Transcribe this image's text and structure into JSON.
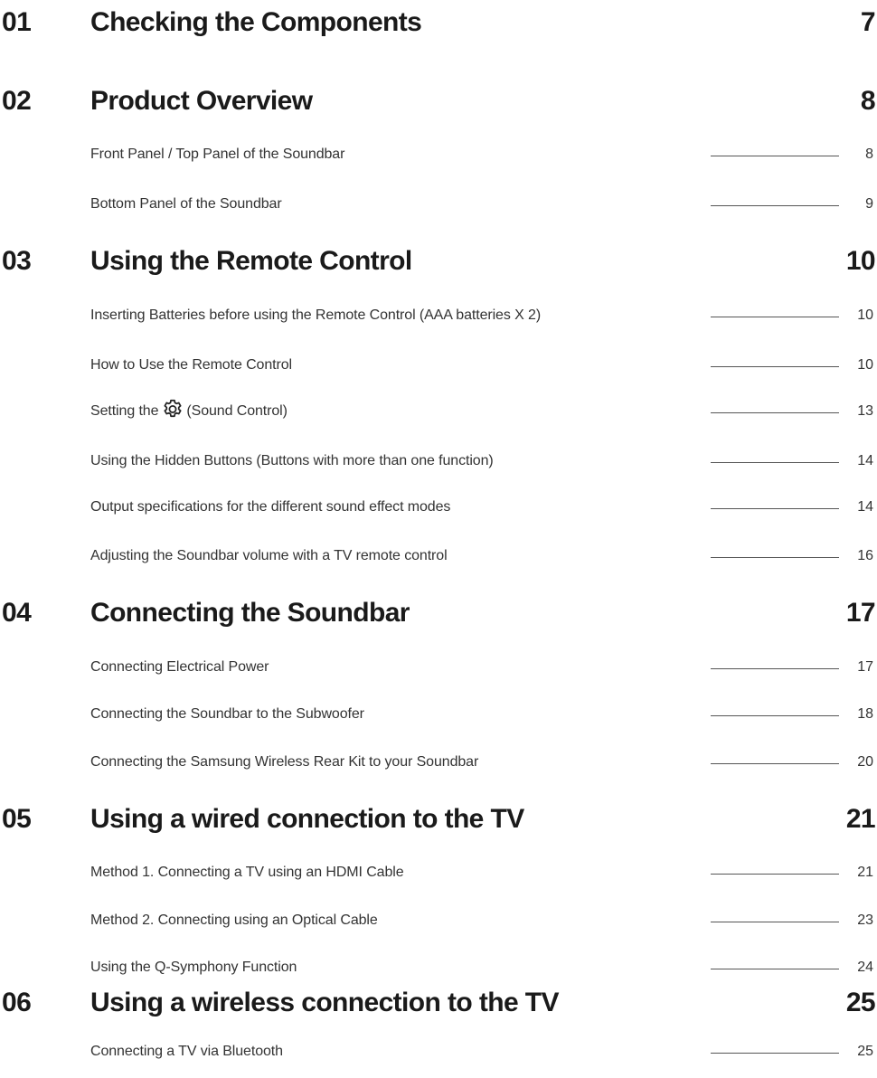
{
  "chapters": [
    {
      "number": "01",
      "title": "Checking the Components",
      "page": "7",
      "entries": []
    },
    {
      "number": "02",
      "title": "Product Overview",
      "page": "8",
      "entries": [
        {
          "title": "Front Panel / Top Panel of the Soundbar",
          "page": "8"
        },
        {
          "title": "Bottom Panel of the Soundbar",
          "page": "9"
        }
      ]
    },
    {
      "number": "03",
      "title": "Using the Remote Control",
      "page": "10",
      "entries": [
        {
          "title": "Inserting Batteries before using the Remote Control (AAA batteries X 2)",
          "page": "10"
        },
        {
          "title": "How to Use the Remote Control",
          "page": "10"
        },
        {
          "title_before": "Setting the",
          "icon": "gear-icon",
          "title_after": "(Sound Control)",
          "page": "13"
        },
        {
          "title": "Using the Hidden Buttons (Buttons with more than one function)",
          "page": "14"
        },
        {
          "title": "Output specifications for the different sound effect modes",
          "page": "14"
        },
        {
          "title": "Adjusting the Soundbar volume with a TV remote control",
          "page": "16"
        }
      ]
    },
    {
      "number": "04",
      "title": "Connecting the Soundbar",
      "page": "17",
      "entries": [
        {
          "title": "Connecting Electrical Power",
          "page": "17"
        },
        {
          "title": "Connecting the Soundbar to the Subwoofer",
          "page": "18"
        },
        {
          "title": "Connecting the Samsung Wireless Rear Kit to your Soundbar",
          "page": "20"
        }
      ]
    },
    {
      "number": "05",
      "title": "Using a wired connection to the TV",
      "page": "21",
      "entries": [
        {
          "title": "Method 1. Connecting a TV using an HDMI Cable",
          "page": "21"
        },
        {
          "title": "Method 2. Connecting using an Optical Cable",
          "page": "23"
        },
        {
          "title": "Using the Q-Symphony Function",
          "page": "24"
        }
      ]
    },
    {
      "number": "06",
      "title": "Using a wireless connection to the TV",
      "page": "25",
      "entries": [
        {
          "title": "Connecting a TV via Bluetooth",
          "page": "25"
        }
      ]
    }
  ]
}
